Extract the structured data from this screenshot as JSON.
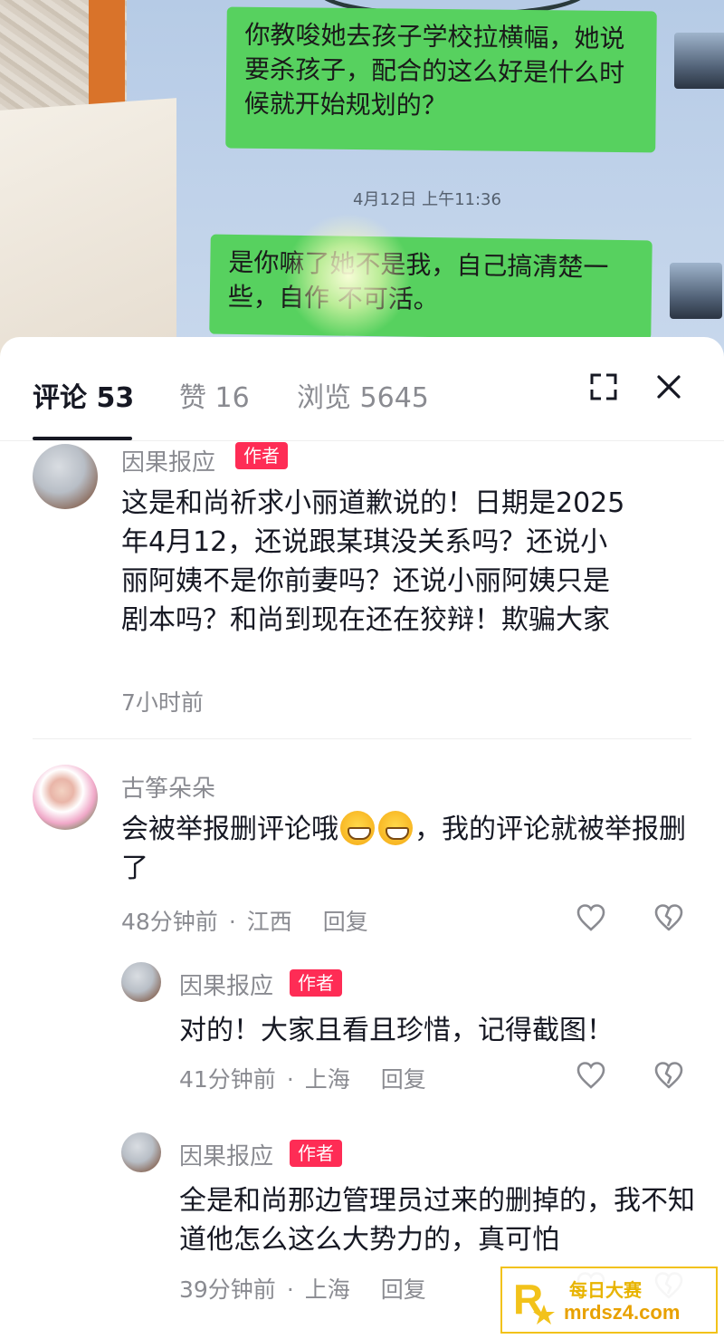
{
  "photo": {
    "bubble1": "你教唆她去孩子学校拉横幅，她说要杀孩子，配合的这么好是什么时候就开始规划的？",
    "timestamp": "4月12日 上午11:36",
    "bubble2": "是你嘛了她不是我，自己搞清楚一些，自作 不可活。"
  },
  "header": {
    "tab_comments": "评论 53",
    "tab_likes": "赞 16",
    "tab_views": "浏览 5645"
  },
  "comments": [
    {
      "name": "因果报应",
      "badge": "作者",
      "text": "这是和尚祈求小丽道歉说的！日期是2025年4月12，还说跟某琪没关系吗？还说小丽阿姨不是你前妻吗？还说小丽阿姨只是剧本吗？和尚到现在还在狡辩！欺骗大家",
      "time": "7小时前"
    },
    {
      "name": "古筝朵朵",
      "text_before": "会被举报删评论哦",
      "text_after": "，我的评论就被举报删了",
      "time": "48分钟前",
      "location": "江西",
      "reply": "回复"
    }
  ],
  "replies": [
    {
      "name": "因果报应",
      "badge": "作者",
      "text": "对的！大家且看且珍惜，记得截图！",
      "time": "41分钟前",
      "location": "上海",
      "reply": "回复"
    },
    {
      "name": "因果报应",
      "badge": "作者",
      "text": "全是和尚那边管理员过来的删掉的，我不知道他怎么这么大势力的，真可怕",
      "time": "39分钟前",
      "location": "上海",
      "reply": "回复"
    }
  ],
  "watermark": {
    "title": "每日大赛",
    "url": "mrdsz4.com"
  },
  "colors": {
    "author_badge": "#fe2c55",
    "chat_bubble": "#57d15f",
    "watermark": "#f2c21a"
  }
}
